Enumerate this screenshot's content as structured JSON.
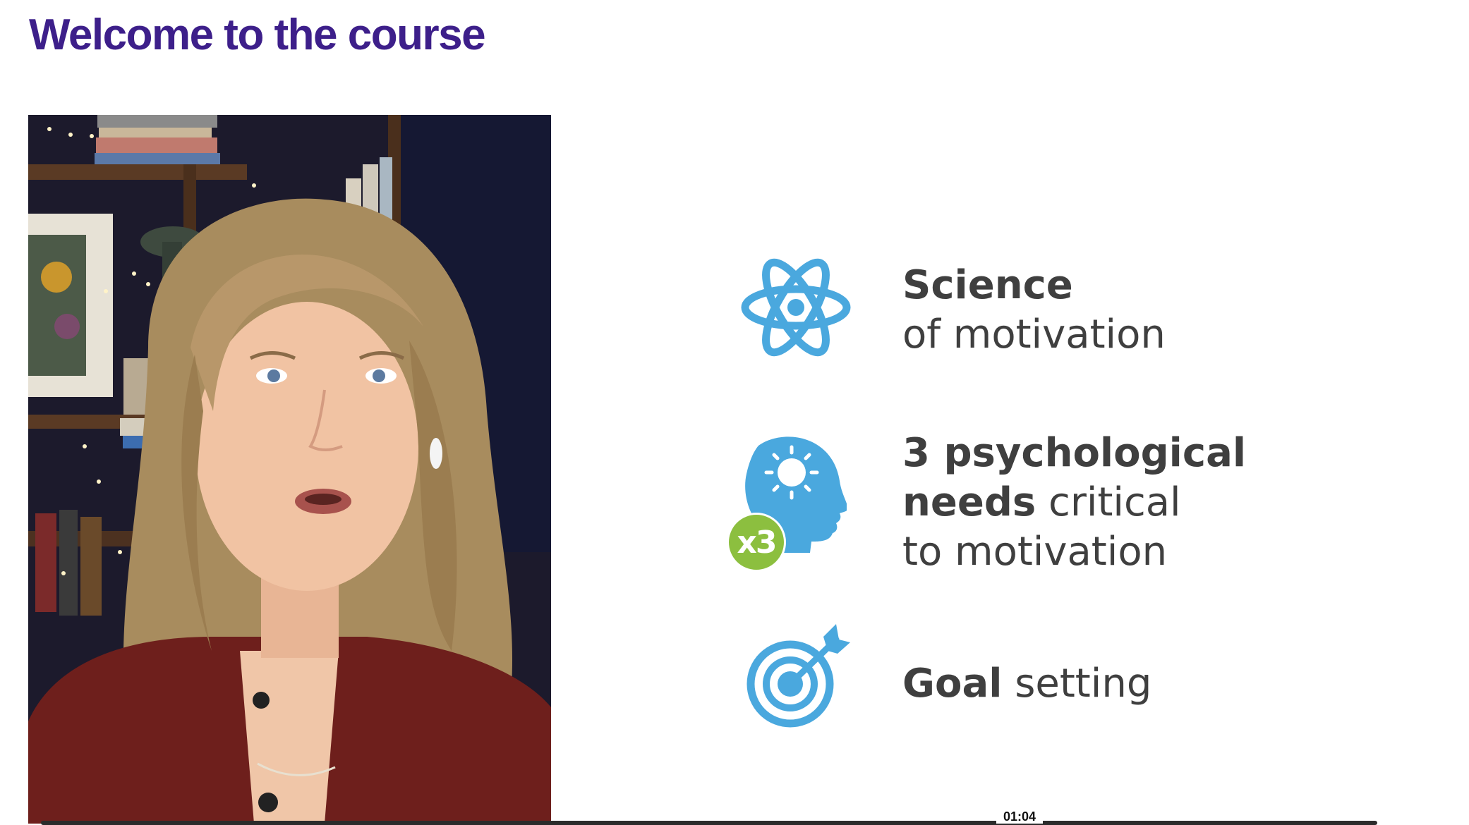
{
  "page": {
    "title": "Welcome to the course"
  },
  "video": {
    "current_time": "01:04"
  },
  "slide": {
    "topics": [
      {
        "icon": "atom-icon",
        "bold": "Science",
        "light": "of motivation"
      },
      {
        "icon": "head-lightbulb-icon",
        "badge": "x3",
        "line1_bold": "3 psychological",
        "line2_bold": "needs",
        "line2_light": " critical",
        "line3_light": "to motivation"
      },
      {
        "icon": "target-icon",
        "bold": "Goal",
        "light": " setting"
      }
    ]
  },
  "colors": {
    "title": "#3d1f8a",
    "icon_blue": "#4aa8de",
    "badge_green": "#8cbf3f",
    "text": "#3f3f3f"
  }
}
